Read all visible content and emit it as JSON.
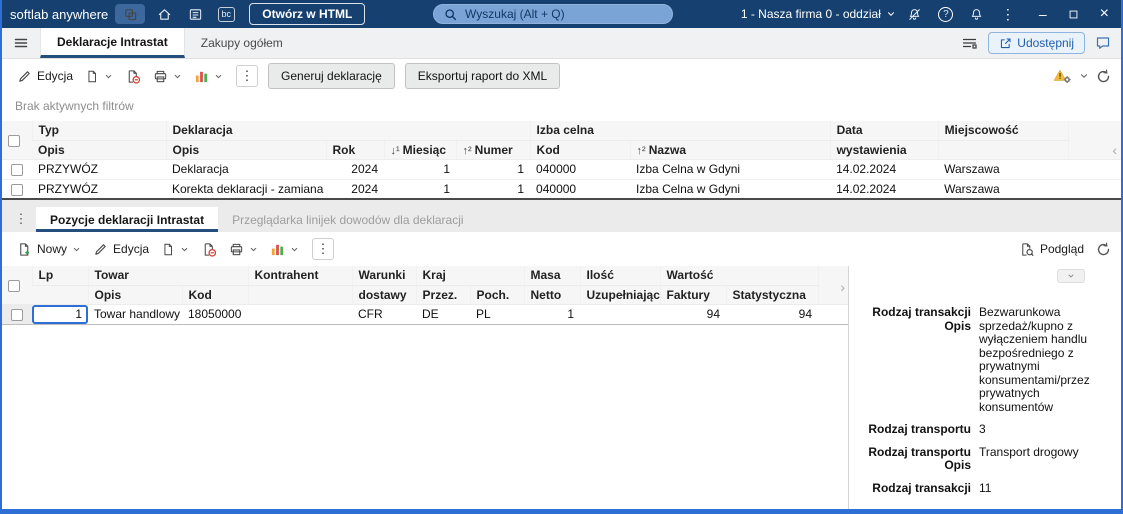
{
  "topbar": {
    "app_name": "softlab anywhere",
    "bc_badge": "bc",
    "open_html_button": "Otwórz w HTML",
    "search_placeholder": "Wyszukaj (Alt + Q)",
    "company_selector": "1 - Nasza firma 0 - oddział",
    "help_glyph": "?"
  },
  "icons": {
    "kebab": "⋮",
    "minimize": "–",
    "close": "×",
    "collapse_left": "‹",
    "expand_right": "›"
  },
  "tabs": {
    "items": [
      {
        "label": "Deklaracje Intrastat"
      },
      {
        "label": "Zakupy ogółem"
      }
    ],
    "share_button": "Udostępnij"
  },
  "toolbar": {
    "edit": "Edycja",
    "generate_button": "Generuj deklarację",
    "export_button": "Eksportuj raport do XML"
  },
  "filter_status": "Brak aktywnych filtrów",
  "declarations_table": {
    "groups": {
      "typ": "Typ",
      "deklaracja": "Deklaracja",
      "izba_celna": "Izba celna",
      "data": "Data",
      "miejscowosc": "Miejscowość"
    },
    "columns": {
      "opis1": "Opis",
      "opis2": "Opis",
      "rok": "Rok",
      "miesiac": "Miesiąc",
      "numer": "Numer",
      "kod": "Kod",
      "nazwa": "Nazwa",
      "wystawienia": "wystawienia"
    },
    "sort": {
      "miesiac": "↓¹",
      "numer": "↑²",
      "nazwa": "↑²"
    },
    "rows": [
      {
        "typ": "PRZYWÓZ",
        "opis": "Deklaracja",
        "rok": "2024",
        "miesiac": "1",
        "numer": "1",
        "kod": "040000",
        "nazwa": "Izba Celna w Gdyni",
        "data": "14.02.2024",
        "miejscowosc": "Warszawa"
      },
      {
        "typ": "PRZYWÓZ",
        "opis": "Korekta deklaracji - zamiana",
        "rok": "2024",
        "miesiac": "1",
        "numer": "1",
        "kod": "040000",
        "nazwa": "Izba Celna w Gdyni",
        "data": "14.02.2024",
        "miejscowosc": "Warszawa"
      }
    ]
  },
  "bottom_tabs": [
    {
      "label": "Pozycje deklaracji Intrastat"
    },
    {
      "label": "Przeglądarka linijek dowodów dla deklaracji"
    }
  ],
  "bottom_toolbar": {
    "new": "Nowy",
    "edit": "Edycja",
    "preview": "Podgląd"
  },
  "positions_table": {
    "groups": {
      "lp": "Lp",
      "towar": "Towar",
      "kontrahent": "Kontrahent",
      "warunki": "Warunki",
      "kraj": "Kraj",
      "masa": "Masa",
      "ilosc": "Ilość",
      "wartosc": "Wartość"
    },
    "columns": {
      "opis": "Opis",
      "kod": "Kod",
      "dostawy": "dostawy",
      "przez": "Przez.",
      "poch": "Poch.",
      "netto": "Netto",
      "uzupelniajaca": "Uzupełniająca",
      "faktury": "Faktury",
      "statystyczna": "Statystyczna"
    },
    "rows": [
      {
        "lp": "1",
        "opis": "Towar handlowy",
        "kod": "18050000",
        "kontrahent": "",
        "dostawy": "CFR",
        "przez": "DE",
        "poch": "PL",
        "netto": "1",
        "uzupelniajaca": "",
        "faktury": "94",
        "statystyczna": "94"
      }
    ]
  },
  "details": {
    "fields": [
      {
        "label1": "Rodzaj transakcji",
        "label2": "Opis",
        "value": "Bezwarunkowa sprzedaż/kupno z wyłączeniem handlu bezpośredniego z prywatnymi konsumentami/przez prywatnych konsumentów"
      },
      {
        "label1": "Rodzaj transportu",
        "label2": "",
        "value": "3"
      },
      {
        "label1": "Rodzaj transportu",
        "label2": "Opis",
        "value": "Transport drogowy"
      },
      {
        "label1": "Rodzaj transakcji",
        "label2": "",
        "value": "11"
      }
    ]
  }
}
